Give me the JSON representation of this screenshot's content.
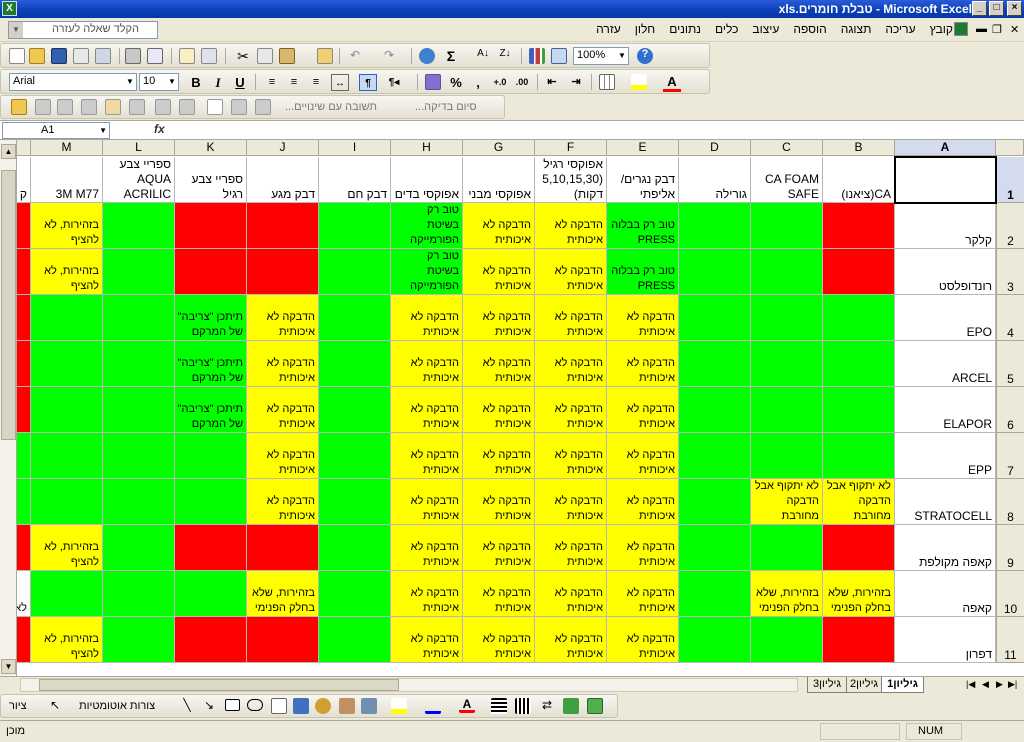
{
  "window": {
    "title": "Microsoft Excel - טבלת חומרים.xls",
    "minimize": "_",
    "maximize": "□",
    "close": "×"
  },
  "menu": {
    "help_placeholder": "הקלד שאלה לעזרה",
    "items": [
      "קובץ",
      "עריכה",
      "תצוגה",
      "הוספה",
      "עיצוב",
      "כלים",
      "נתונים",
      "חלון",
      "עזרה"
    ]
  },
  "toolbar": {
    "zoom": "100%",
    "font_name": "Arial",
    "font_size": "10",
    "bold": "B",
    "italic": "I",
    "underline": "U",
    "percent": "%",
    "comma": ",",
    "autosum": "Σ"
  },
  "reviewbar": {
    "reply_label": "תשובה עם שינויים...",
    "end_review_label": "סיום בדיקה..."
  },
  "formula_bar": {
    "name_box": "A1",
    "fx": "fx",
    "content": ""
  },
  "columns": [
    "A",
    "B",
    "C",
    "D",
    "E",
    "F",
    "G",
    "H",
    "I",
    "J",
    "K",
    "L",
    "M",
    ""
  ],
  "header_row": [
    "",
    "CA(ציאנו)",
    "CA FOAM SAFE",
    "גורילה",
    "דבק נגרים/ אליפתי",
    "אפוקסי רגיל (5,10,15,30 דקות)",
    "אפוקסי מבני",
    "אפוקסי בדים",
    "דבק חם",
    "דבק מגע",
    "ספריי צבע רגיל",
    "ספריי צבע AQUA ACRILIC",
    "3M M77",
    "ק"
  ],
  "rows": [
    {
      "num": "2",
      "label": "קלקר",
      "cells": [
        [
          "r",
          ""
        ],
        [
          "g",
          ""
        ],
        [
          "g",
          ""
        ],
        [
          "g",
          "טוב רק בבלוה PRESS"
        ],
        [
          "y",
          "הדבקה לא איכותית"
        ],
        [
          "y",
          "הדבקה לא איכותית"
        ],
        [
          "g",
          "טוב רק בשיטת הפורמייקה"
        ],
        [
          "g",
          ""
        ],
        [
          "r",
          ""
        ],
        [
          "r",
          ""
        ],
        [
          "g",
          ""
        ],
        [
          "y",
          "בזהירות, לא להציף"
        ],
        [
          "r",
          ""
        ]
      ]
    },
    {
      "num": "3",
      "label": "רונדופלסט",
      "cells": [
        [
          "r",
          ""
        ],
        [
          "g",
          ""
        ],
        [
          "g",
          ""
        ],
        [
          "g",
          "טוב רק בבלוה PRESS"
        ],
        [
          "y",
          "הדבקה לא איכותית"
        ],
        [
          "y",
          "הדבקה לא איכותית"
        ],
        [
          "g",
          "טוב רק בשיטת הפורמייקה"
        ],
        [
          "g",
          ""
        ],
        [
          "r",
          ""
        ],
        [
          "r",
          ""
        ],
        [
          "g",
          ""
        ],
        [
          "y",
          "בזהירות, לא להציף"
        ],
        [
          "r",
          ""
        ]
      ]
    },
    {
      "num": "4",
      "label": "EPO",
      "cells": [
        [
          "g",
          ""
        ],
        [
          "g",
          ""
        ],
        [
          "g",
          ""
        ],
        [
          "y",
          "הדבקה לא איכותית"
        ],
        [
          "y",
          "הדבקה לא איכותית"
        ],
        [
          "y",
          "הדבקה לא איכותית"
        ],
        [
          "y",
          "הדבקה לא איכותית"
        ],
        [
          "g",
          ""
        ],
        [
          "y",
          "הדבקה לא איכותית"
        ],
        [
          "g",
          "תיתכן \"צריבה\" של המרקם"
        ],
        [
          "g",
          ""
        ],
        [
          "g",
          ""
        ],
        [
          "r",
          ""
        ]
      ]
    },
    {
      "num": "5",
      "label": "ARCEL",
      "cells": [
        [
          "g",
          ""
        ],
        [
          "g",
          ""
        ],
        [
          "g",
          ""
        ],
        [
          "y",
          "הדבקה לא איכותית"
        ],
        [
          "y",
          "הדבקה לא איכותית"
        ],
        [
          "y",
          "הדבקה לא איכותית"
        ],
        [
          "y",
          "הדבקה לא איכותית"
        ],
        [
          "g",
          ""
        ],
        [
          "y",
          "הדבקה לא איכותית"
        ],
        [
          "g",
          "תיתכן \"צריבה\" של המרקם"
        ],
        [
          "g",
          ""
        ],
        [
          "g",
          ""
        ],
        [
          "r",
          ""
        ]
      ]
    },
    {
      "num": "6",
      "label": "ELAPOR",
      "cells": [
        [
          "g",
          ""
        ],
        [
          "g",
          ""
        ],
        [
          "g",
          ""
        ],
        [
          "y",
          "הדבקה לא איכותית"
        ],
        [
          "y",
          "הדבקה לא איכותית"
        ],
        [
          "y",
          "הדבקה לא איכותית"
        ],
        [
          "y",
          "הדבקה לא איכותית"
        ],
        [
          "g",
          ""
        ],
        [
          "y",
          "הדבקה לא איכותית"
        ],
        [
          "g",
          "תיתכן \"צריבה\" של המרקם"
        ],
        [
          "g",
          ""
        ],
        [
          "g",
          ""
        ],
        [
          "r",
          ""
        ]
      ]
    },
    {
      "num": "7",
      "label": "EPP",
      "cells": [
        [
          "g",
          ""
        ],
        [
          "g",
          ""
        ],
        [
          "g",
          ""
        ],
        [
          "y",
          "הדבקה לא איכותית"
        ],
        [
          "y",
          "הדבקה לא איכותית"
        ],
        [
          "y",
          "הדבקה לא איכותית"
        ],
        [
          "y",
          "הדבקה לא איכותית"
        ],
        [
          "g",
          ""
        ],
        [
          "y",
          "הדבקה לא איכותית"
        ],
        [
          "g",
          ""
        ],
        [
          "g",
          ""
        ],
        [
          "g",
          ""
        ],
        [
          "g",
          ""
        ]
      ]
    },
    {
      "num": "8",
      "label": "STRATOCELL",
      "cells": [
        [
          "y",
          "לא יתקוף אבל הדבקה מחורבת"
        ],
        [
          "y",
          "לא יתקוף אבל הדבקה מחורבת"
        ],
        [
          "g",
          ""
        ],
        [
          "y",
          "הדבקה לא איכותית"
        ],
        [
          "y",
          "הדבקה לא איכותית"
        ],
        [
          "y",
          "הדבקה לא איכותית"
        ],
        [
          "y",
          "הדבקה לא איכותית"
        ],
        [
          "g",
          ""
        ],
        [
          "y",
          "הדבקה לא איכותית"
        ],
        [
          "g",
          ""
        ],
        [
          "g",
          ""
        ],
        [
          "g",
          ""
        ],
        [
          "g",
          ""
        ]
      ]
    },
    {
      "num": "9",
      "label": "קאפה מקולפת",
      "cells": [
        [
          "r",
          ""
        ],
        [
          "g",
          ""
        ],
        [
          "g",
          ""
        ],
        [
          "y",
          "הדבקה לא איכותית"
        ],
        [
          "y",
          "הדבקה לא איכותית"
        ],
        [
          "y",
          "הדבקה לא איכותית"
        ],
        [
          "y",
          "הדבקה לא איכותית"
        ],
        [
          "g",
          ""
        ],
        [
          "r",
          ""
        ],
        [
          "r",
          ""
        ],
        [
          "g",
          ""
        ],
        [
          "y",
          "בזהירות, לא להציף"
        ],
        [
          "r",
          ""
        ]
      ]
    },
    {
      "num": "10",
      "label": "קאפה",
      "cells": [
        [
          "y",
          "בזהירות, שלא בחלק הפנימי"
        ],
        [
          "y",
          "בזהירות, שלא בחלק הפנימי"
        ],
        [
          "g",
          ""
        ],
        [
          "y",
          "הדבקה לא איכותית"
        ],
        [
          "y",
          "הדבקה לא איכותית"
        ],
        [
          "y",
          "הדבקה לא איכותית"
        ],
        [
          "y",
          "הדבקה לא איכותית"
        ],
        [
          "g",
          ""
        ],
        [
          "y",
          "בזהירות, שלא בחלק הפנימי"
        ],
        [
          "g",
          ""
        ],
        [
          "g",
          ""
        ],
        [
          "g",
          ""
        ],
        [
          "w",
          "לא"
        ]
      ]
    },
    {
      "num": "11",
      "label": "דפרון",
      "cells": [
        [
          "r",
          ""
        ],
        [
          "g",
          ""
        ],
        [
          "g",
          ""
        ],
        [
          "y",
          "הדבקה לא איכותית"
        ],
        [
          "y",
          "הדבקה לא איכותית"
        ],
        [
          "y",
          "הדבקה לא איכותית"
        ],
        [
          "y",
          "הדבקה לא איכותית"
        ],
        [
          "g",
          ""
        ],
        [
          "r",
          ""
        ],
        [
          "r",
          ""
        ],
        [
          "g",
          ""
        ],
        [
          "y",
          "בזהירות, לא להציף"
        ],
        [
          "r",
          ""
        ]
      ]
    }
  ],
  "sheet_tabs": [
    "גיליון1",
    "גיליון2",
    "גיליון3"
  ],
  "drawbar": {
    "draw_label": "ציור",
    "autoshapes_label": "צורות אוטומטיות"
  },
  "status": {
    "ready": "מוכן",
    "num": "NUM"
  },
  "colors": {
    "green": "#00ff00",
    "yellow": "#ffff00",
    "red": "#ff0000",
    "title_blue": "#0a3fb8"
  }
}
